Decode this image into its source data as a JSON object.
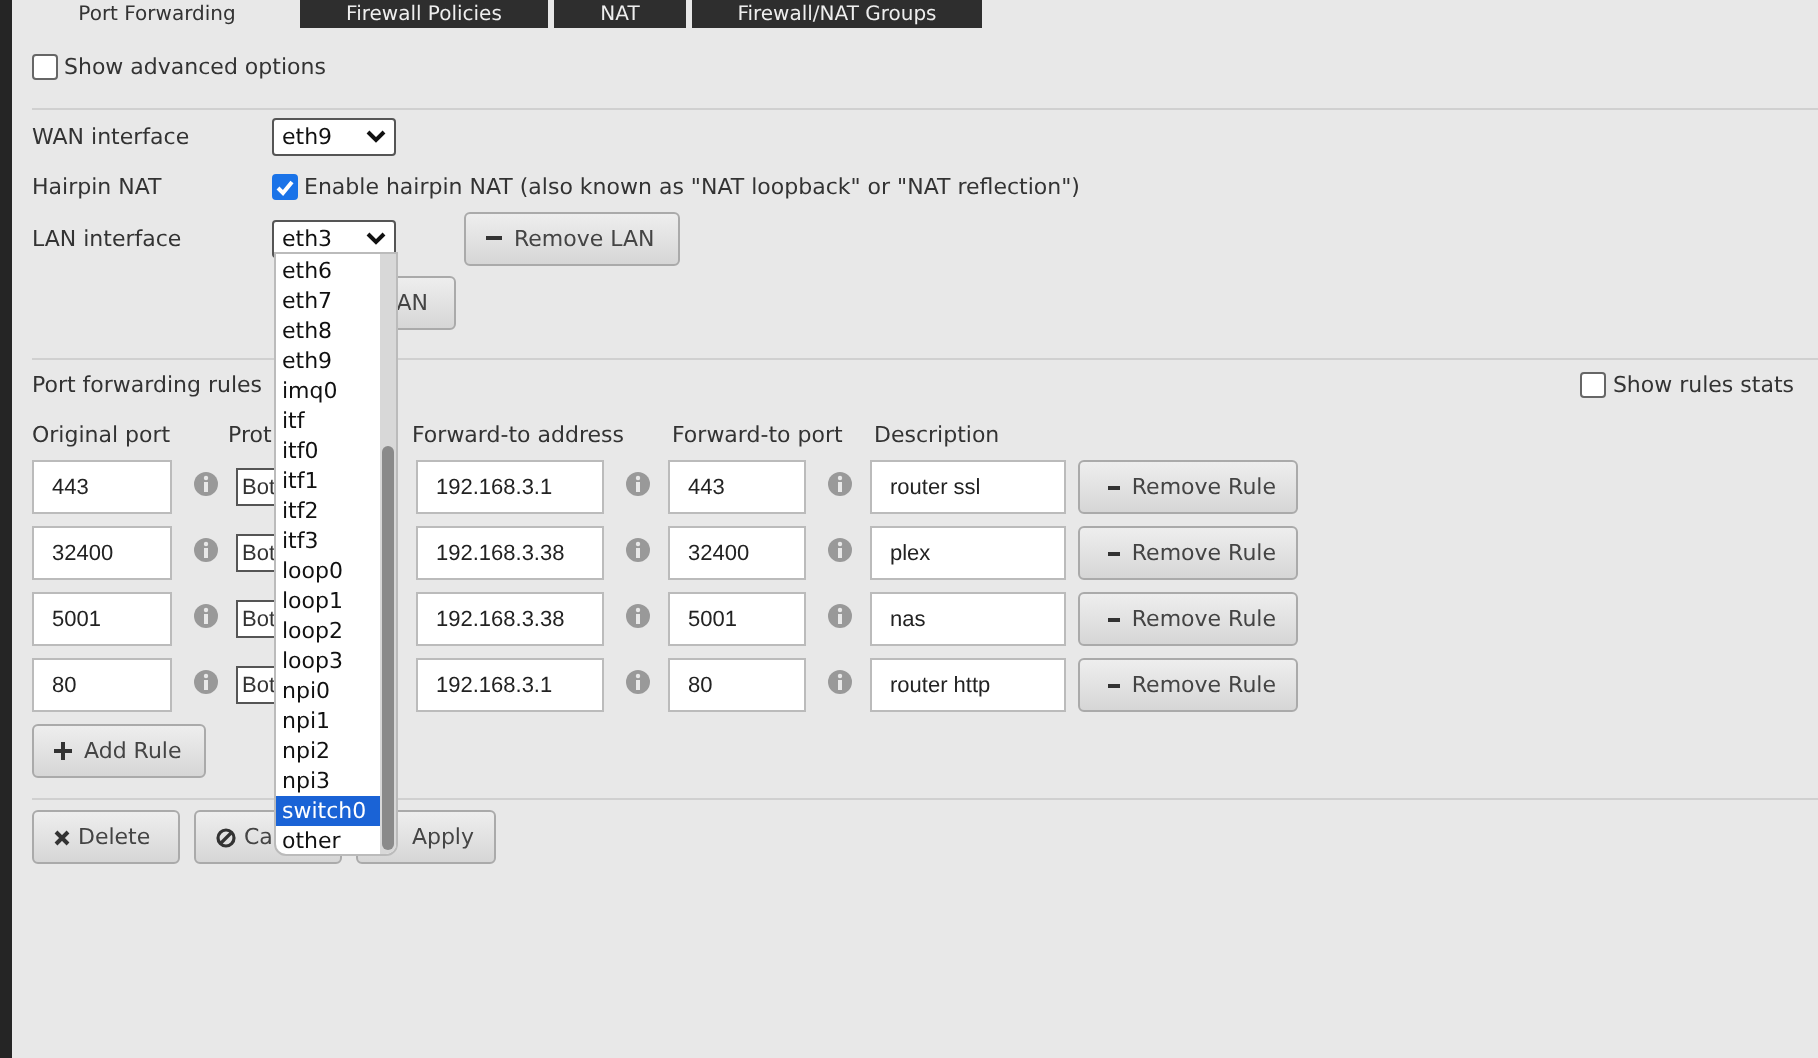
{
  "tabs": [
    {
      "label": "Port Forwarding",
      "selected": true
    },
    {
      "label": "Firewall Policies",
      "selected": false
    },
    {
      "label": "NAT",
      "selected": false
    },
    {
      "label": "Firewall/NAT Groups",
      "selected": false
    }
  ],
  "show_advanced": {
    "label": "Show advanced options",
    "checked": false
  },
  "wan_interface": {
    "label": "WAN interface",
    "value": "eth9"
  },
  "hairpin_nat": {
    "label": "Hairpin NAT",
    "checkbox_label": "Enable hairpin NAT (also known as \"NAT loopback\" or \"NAT reflection\")",
    "checked": true
  },
  "lan_interface": {
    "label": "LAN interface",
    "value": "eth3",
    "remove_button": "Remove LAN",
    "add_button": "AN",
    "dropdown": [
      {
        "label": "eth6",
        "selected": false
      },
      {
        "label": "eth7",
        "selected": false
      },
      {
        "label": "eth8",
        "selected": false
      },
      {
        "label": "eth9",
        "selected": false
      },
      {
        "label": "imq0",
        "selected": false
      },
      {
        "label": "itf",
        "selected": false
      },
      {
        "label": "itf0",
        "selected": false
      },
      {
        "label": "itf1",
        "selected": false
      },
      {
        "label": "itf2",
        "selected": false
      },
      {
        "label": "itf3",
        "selected": false
      },
      {
        "label": "loop0",
        "selected": false
      },
      {
        "label": "loop1",
        "selected": false
      },
      {
        "label": "loop2",
        "selected": false
      },
      {
        "label": "loop3",
        "selected": false
      },
      {
        "label": "npi0",
        "selected": false
      },
      {
        "label": "npi1",
        "selected": false
      },
      {
        "label": "npi2",
        "selected": false
      },
      {
        "label": "npi3",
        "selected": false
      },
      {
        "label": "switch0",
        "selected": true
      },
      {
        "label": "other",
        "selected": false
      }
    ]
  },
  "rules": {
    "title": "Port forwarding rules",
    "show_stats": {
      "label": "Show rules stats",
      "checked": false
    },
    "columns": [
      "Original port",
      "Prot",
      "Forward-to address",
      "Forward-to port",
      "Description"
    ],
    "rows": [
      {
        "original_port": "443",
        "protocol": "Bot",
        "address": "192.168.3.1",
        "forward_port": "443",
        "description": "router ssl",
        "remove": "Remove Rule"
      },
      {
        "original_port": "32400",
        "protocol": "Bot",
        "address": "192.168.3.38",
        "forward_port": "32400",
        "description": "plex",
        "remove": "Remove Rule"
      },
      {
        "original_port": "5001",
        "protocol": "Bot",
        "address": "192.168.3.38",
        "forward_port": "5001",
        "description": "nas",
        "remove": "Remove Rule"
      },
      {
        "original_port": "80",
        "protocol": "Bot",
        "address": "192.168.3.1",
        "forward_port": "80",
        "description": "router http",
        "remove": "Remove Rule"
      }
    ],
    "add_button": "Add Rule"
  },
  "footer_buttons": [
    {
      "kind": "delete",
      "label": "Delete"
    },
    {
      "kind": "cancel",
      "label": "Ca"
    },
    {
      "kind": "apply",
      "label": "Apply"
    }
  ]
}
